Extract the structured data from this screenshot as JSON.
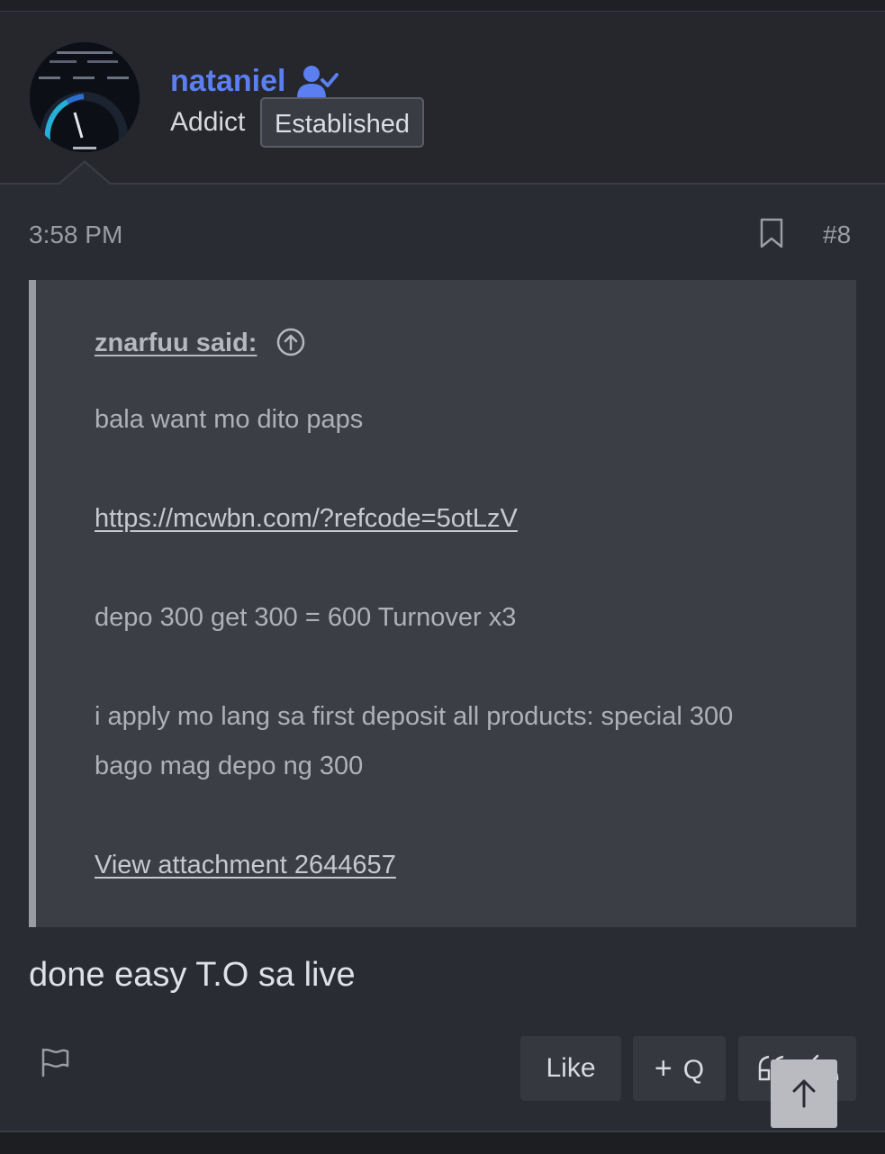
{
  "user": {
    "name": "nataniel",
    "title": "Addict",
    "badge": "Established"
  },
  "post": {
    "time": "3:58 PM",
    "number": "#8",
    "body": "done easy T.O sa live"
  },
  "quote": {
    "attribution": "znarfuu said:",
    "line1": "bala want mo dito paps",
    "link": "https://mcwbn.com/?refcode=5otLzV",
    "line2": "depo 300 get 300 = 600 Turnover x3",
    "line3": "i apply mo lang sa first deposit all products: special 300",
    "line4": "bago mag depo ng 300",
    "attachment": "View attachment 2644657"
  },
  "actions": {
    "like": "Like",
    "multiquote": "Q",
    "multiquote_prefix": "+"
  },
  "colors": {
    "username": "#5b7ff0",
    "background": "#2a2c33",
    "quote_bg": "#3c3e46"
  }
}
